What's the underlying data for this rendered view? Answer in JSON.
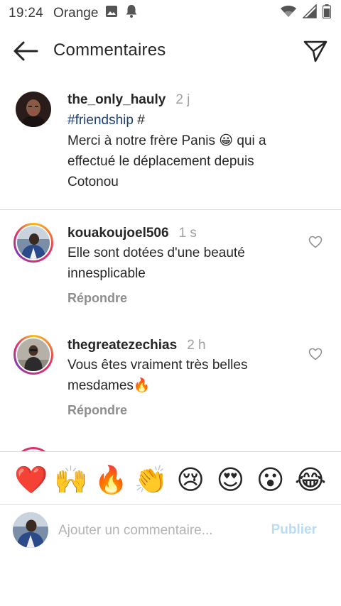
{
  "status_bar": {
    "time": "19:24",
    "carrier": "Orange",
    "icons": [
      "image-icon",
      "notification-bell-icon",
      "wifi-icon",
      "signal-icon",
      "battery-icon"
    ]
  },
  "header": {
    "title": "Commentaires",
    "back_icon": "arrow-left-icon",
    "send_icon": "paper-plane-icon"
  },
  "caption": {
    "username": "the_only_hauly",
    "time": "2 j",
    "hashtag": "#friendship",
    "hashtag_suffix": " #",
    "line1": "Merci à notre frère Panis 😀 qui a",
    "line2": "effectué le déplacement depuis",
    "line3": "Cotonou"
  },
  "comments": [
    {
      "username": "kouakoujoel506",
      "time": "1 s",
      "line1": "Elle sont dotées d'une beauté",
      "line2": "innesplicable",
      "reply": "Répondre"
    },
    {
      "username": "thegreatezechias",
      "time": "2 h",
      "line1": "Vous êtes vraiment très belles",
      "line2": "mesdames🔥",
      "reply": "Répondre"
    }
  ],
  "emoji_bar": [
    "❤️",
    "🙌",
    "🔥",
    "👏",
    "😢",
    "😍",
    "😮",
    "😂"
  ],
  "composer": {
    "placeholder": "Ajouter un commentaire...",
    "publish_label": "Publier"
  },
  "colors": {
    "text": "#262626",
    "muted": "#8e8e8e",
    "hashtag": "#1c3f77",
    "publish_disabled": "#b9dcf5",
    "divider": "#dbdbdb"
  }
}
